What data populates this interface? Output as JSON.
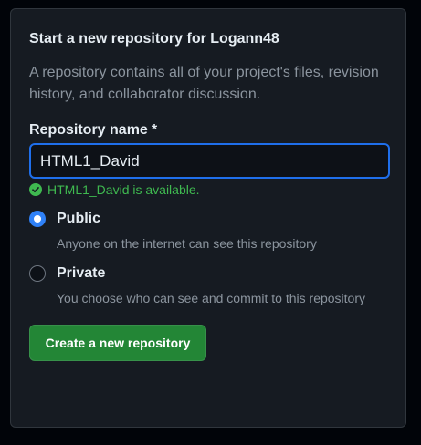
{
  "form": {
    "title": "Start a new repository for Logann48",
    "description": "A repository contains all of your project's files, revision history, and collaborator discussion.",
    "name_label": "Repository name",
    "required_marker": "*",
    "name_value": "HTML1_David",
    "validation_message": "HTML1_David is available.",
    "visibility": {
      "selected": "Public",
      "options": [
        {
          "label": "Public",
          "description": "Anyone on the internet can see this repository"
        },
        {
          "label": "Private",
          "description": "You choose who can see and commit to this repository"
        }
      ]
    },
    "submit_label": "Create a new repository"
  },
  "colors": {
    "page_background": "#010409",
    "card_background": "#161b22",
    "accent_blue": "#2f81f7",
    "success_green": "#3fb950",
    "button_green": "#238636"
  },
  "icons": {
    "validation": "check-circle-icon"
  }
}
